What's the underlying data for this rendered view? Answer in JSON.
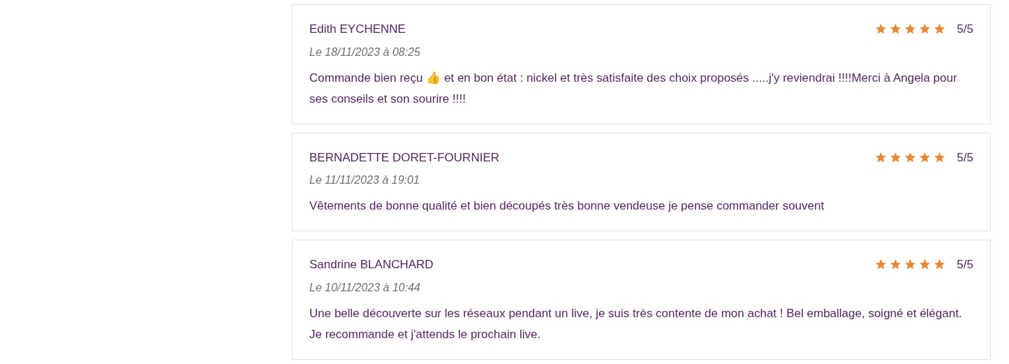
{
  "reviews": [
    {
      "author": "Edith EYCHENNE",
      "date": "Le 18/11/2023 à 08:25",
      "stars": 5,
      "score": "5/5",
      "comment": "Commande bien reçu 👍 et en bon état : nickel et très satisfaite des choix proposés .....j'y reviendrai !!!!Merci à Angela pour ses conseils et son sourire !!!!"
    },
    {
      "author": "BERNADETTE DORET-FOURNIER",
      "date": "Le 11/11/2023 à 19:01",
      "stars": 5,
      "score": "5/5",
      "comment": "Vêtements de bonne qualité et bien découpés très bonne vendeuse je pense commander souvent"
    },
    {
      "author": "Sandrine BLANCHARD",
      "date": "Le 10/11/2023 à 10:44",
      "stars": 5,
      "score": "5/5",
      "comment": "Une belle découverte sur les réseaux pendant un live, je suis très contente de mon achat ! Bel emballage, soigné et élégant. Je recommande et j'attends le prochain live."
    }
  ]
}
